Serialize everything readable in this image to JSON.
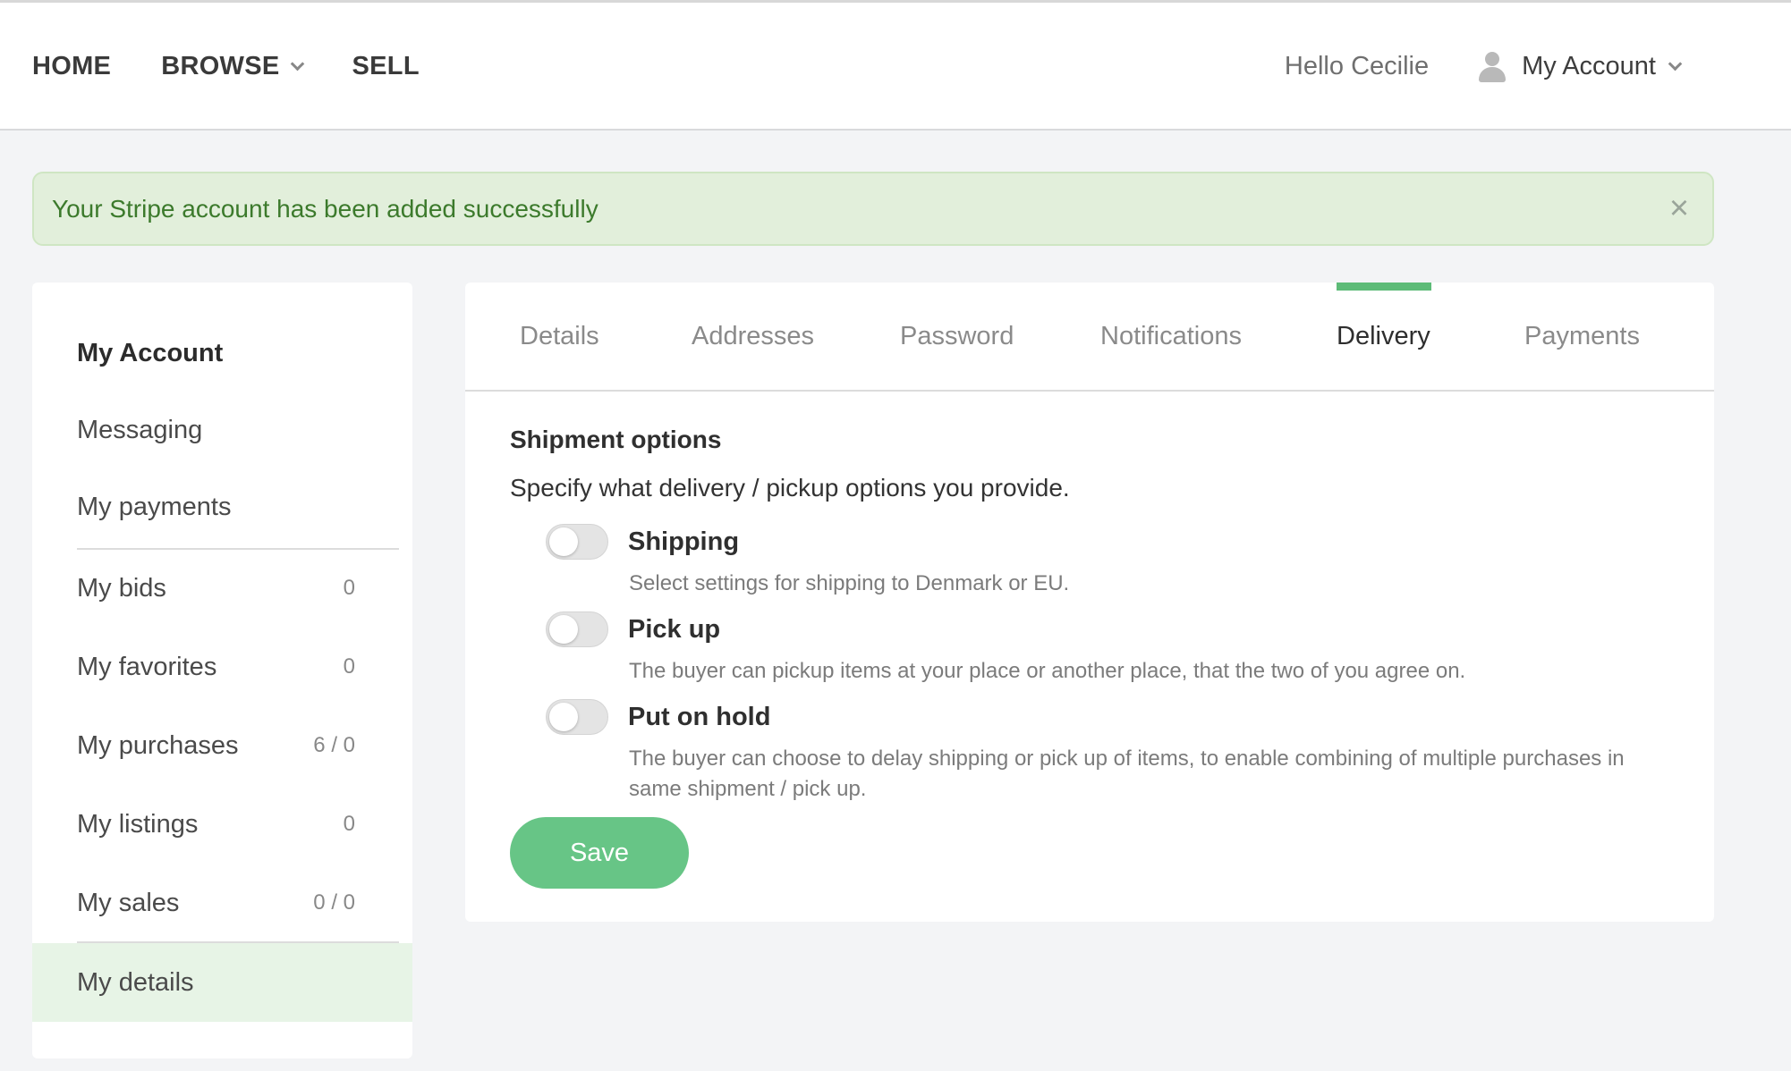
{
  "nav": {
    "home": "HOME",
    "browse": "BROWSE",
    "sell": "SELL",
    "greeting": "Hello Cecilie",
    "account": "My Account"
  },
  "alert": {
    "message": "Your Stripe account has been added successfully",
    "close": "×"
  },
  "sidebar": {
    "items": [
      {
        "label": "My Account",
        "count": ""
      },
      {
        "label": "Messaging",
        "count": ""
      },
      {
        "label": "My payments",
        "count": ""
      },
      {
        "label": "My bids",
        "count": "0"
      },
      {
        "label": "My favorites",
        "count": "0"
      },
      {
        "label": "My purchases",
        "count": "6 / 0"
      },
      {
        "label": "My listings",
        "count": "0"
      },
      {
        "label": "My sales",
        "count": "0 / 0"
      },
      {
        "label": "My details",
        "count": ""
      }
    ],
    "active": "My details"
  },
  "tabs": [
    {
      "label": "Details"
    },
    {
      "label": "Addresses"
    },
    {
      "label": "Password"
    },
    {
      "label": "Notifications"
    },
    {
      "label": "Delivery"
    },
    {
      "label": "Payments"
    }
  ],
  "active_tab": "Delivery",
  "shipment": {
    "title": "Shipment options",
    "description": "Specify what delivery / pickup options you provide.",
    "options": [
      {
        "title": "Shipping",
        "description": "Select settings for shipping to Denmark or EU.",
        "enabled": false
      },
      {
        "title": "Pick up",
        "description": "The buyer can pickup items at your place or another place, that the two of you agree on.",
        "enabled": false
      },
      {
        "title": "Put on hold",
        "description": "The buyer can choose to delay shipping or pick up of items, to enable combining of multiple purchases in same shipment / pick up.",
        "enabled": false
      }
    ],
    "save_label": "Save"
  },
  "colors": {
    "accent": "#5dbb78",
    "save_button": "#67c586",
    "alert_bg": "#e2efdb",
    "alert_text": "#3c7a2c",
    "active_sidebar_bg": "#e7f4e6"
  }
}
